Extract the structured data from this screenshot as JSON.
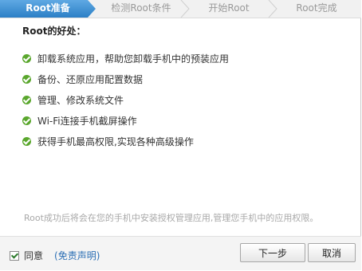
{
  "steps": [
    {
      "label": "Root准备"
    },
    {
      "label": "检测Root条件"
    },
    {
      "label": "开始Root"
    },
    {
      "label": "Root完成"
    }
  ],
  "active_step": 0,
  "heading": "Root的好处：",
  "benefits": [
    "卸载系统应用，帮助您卸载手机中的预装应用",
    "备份、还原应用配置数据",
    "管理、修改系统文件",
    "Wi-Fi连接手机截屏操作",
    "获得手机最高权限,实现各种高级操作"
  ],
  "note": "Root成功后将会在您的手机中安装授权管理应用,管理您手机中的应用权限。",
  "footer": {
    "agree_label": "同意",
    "agree_checked": true,
    "disclaimer_link": "(免责声明)",
    "next_button": "下一步",
    "cancel_button": "取消"
  },
  "colors": {
    "active_step": "#2c7fc6",
    "check": "#5aa72d",
    "link": "#2c6fb5"
  }
}
